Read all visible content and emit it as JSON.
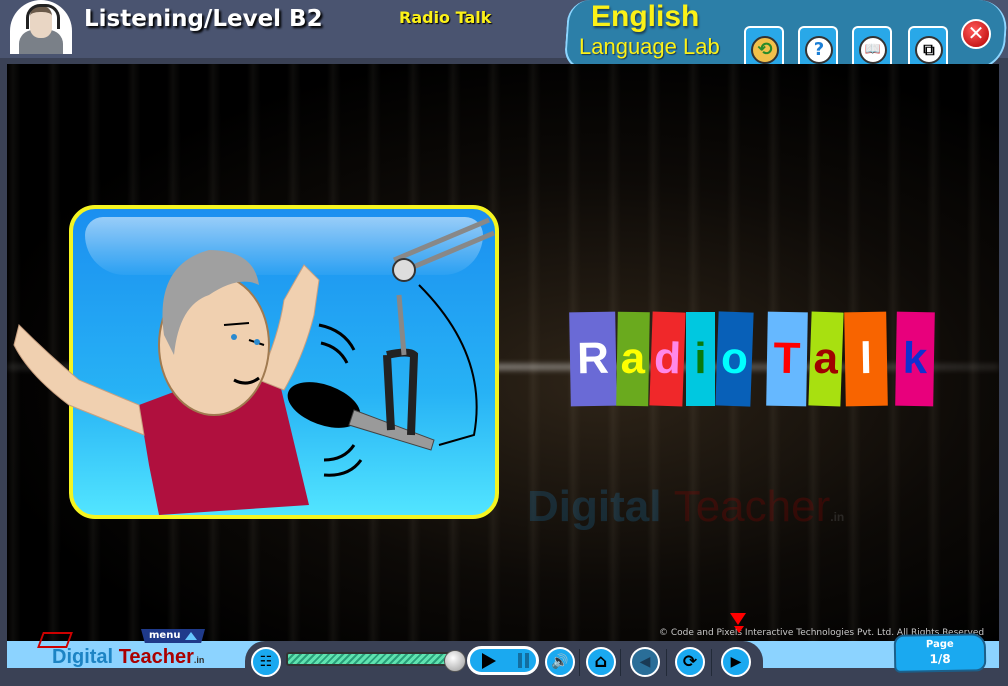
{
  "header": {
    "breadcrumb": "Listening/Level B2",
    "lesson_title": "Radio Talk",
    "brand_line1": "English",
    "brand_line2": "Language Lab",
    "toolbar": [
      {
        "name": "history-folder-button",
        "icon": "folder-clock-icon",
        "glyph": "⟲"
      },
      {
        "name": "help-button",
        "icon": "question-icon",
        "glyph": "?"
      },
      {
        "name": "glossary-button",
        "icon": "book-icon",
        "glyph": "📖"
      },
      {
        "name": "window-resize-button",
        "icon": "resize-window-icon",
        "glyph": "⧉"
      }
    ],
    "close_glyph": "✕"
  },
  "stage": {
    "title_letters": [
      {
        "char": "R",
        "bg": "#6a6ad6",
        "fg": "#ffffff"
      },
      {
        "char": "a",
        "bg": "#6aaa1e",
        "fg": "#ffff00"
      },
      {
        "char": "d",
        "bg": "#f0282a",
        "fg": "#ff88e8"
      },
      {
        "char": "i",
        "bg": "#00c8e0",
        "fg": "#0a7a0a"
      },
      {
        "char": "o",
        "bg": "#0860b8",
        "fg": "#00ffff"
      },
      {
        "char": "T",
        "bg": "#66b8ff",
        "fg": "#ff0000"
      },
      {
        "char": "a",
        "bg": "#a8e010",
        "fg": "#a00000"
      },
      {
        "char": "l",
        "bg": "#f86400",
        "fg": "#ffffff"
      },
      {
        "char": "k",
        "bg": "#e8007c",
        "fg": "#1030d0"
      }
    ],
    "watermark_part1": "Digital",
    "watermark_part2": "Teacher",
    "watermark_suffix": ".in",
    "image_alt": "Radio host speaking into a studio microphone"
  },
  "footer": {
    "menu_label": "menu",
    "logo_part1": "Digital",
    "logo_part2": "Teacher",
    "logo_suffix": ".in",
    "copyright": "© Code and Pixels Interactive Technologies  Pvt. Ltd. All Rights Reserved",
    "progress_fraction": 0.97,
    "page_label": "Page",
    "page_value": "1/8",
    "controls": {
      "sitemap_glyph": "☷",
      "volume_glyph": "🔊",
      "home_glyph": "⌂",
      "back_glyph": "◀",
      "replay_glyph": "⟳",
      "next_glyph": "▶"
    }
  }
}
